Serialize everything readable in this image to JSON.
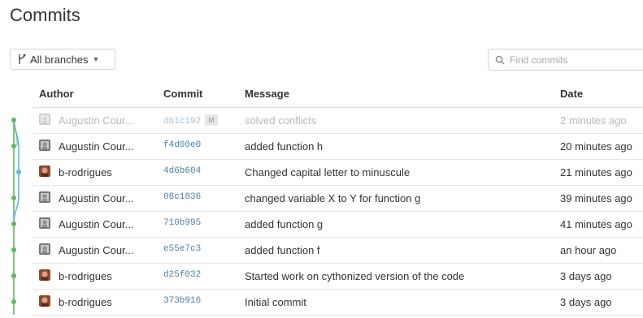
{
  "page": {
    "title": "Commits"
  },
  "branch_selector": {
    "label": "All branches"
  },
  "search": {
    "placeholder": "Find commits"
  },
  "table": {
    "columns": {
      "author": "Author",
      "commit": "Commit",
      "message": "Message",
      "date": "Date"
    },
    "rows": [
      {
        "author": "Augustin Cour...",
        "avatar": "gray",
        "hash": "db1c192",
        "badge": "M",
        "message": "solved conflicts",
        "date": "2 minutes ago",
        "faded": true
      },
      {
        "author": "Augustin Cour...",
        "avatar": "gray",
        "hash": "f4d00e0",
        "message": "added function h",
        "date": "20 minutes ago"
      },
      {
        "author": "b-rodrigues",
        "avatar": "brown",
        "hash": "4d6b604",
        "message": "Changed capital letter to minuscule",
        "date": "21 minutes ago"
      },
      {
        "author": "Augustin Cour...",
        "avatar": "gray",
        "hash": "08c1836",
        "message": "changed variable X to Y for function g",
        "date": "39 minutes ago"
      },
      {
        "author": "Augustin Cour...",
        "avatar": "gray",
        "hash": "710b995",
        "message": "added function g",
        "date": "41 minutes ago"
      },
      {
        "author": "Augustin Cour...",
        "avatar": "gray",
        "hash": "e55e7c3",
        "message": "added function f",
        "date": "an hour ago"
      },
      {
        "author": "b-rodrigues",
        "avatar": "brown",
        "hash": "d25f032",
        "message": "Started work on cythonized version of the code",
        "date": "3 days ago"
      },
      {
        "author": "b-rodrigues",
        "avatar": "brown",
        "hash": "373b916",
        "message": "Initial commit",
        "date": "3 days ago"
      }
    ]
  },
  "colors": {
    "graph_main": "#5fb85a",
    "graph_branch": "#65b5e6",
    "hash": "#4a7fa5"
  },
  "icons": {
    "branch": "git-branch-icon",
    "caret": "caret-down-icon",
    "search": "search-icon"
  }
}
